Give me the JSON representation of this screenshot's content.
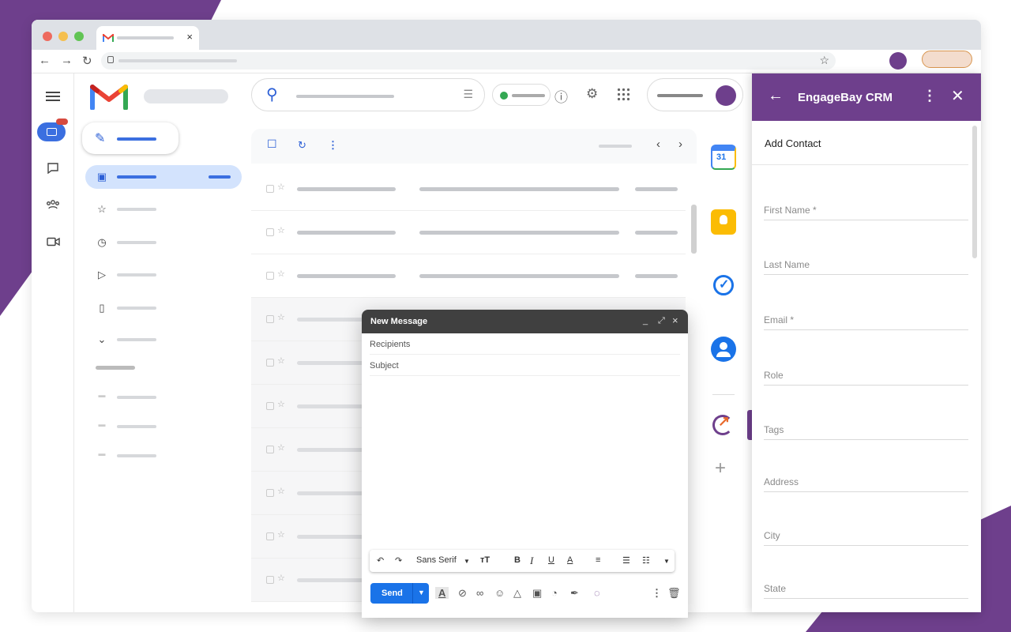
{
  "browser": {
    "dot_colors": [
      "#ee6a5e",
      "#f5bf4f",
      "#61c454"
    ],
    "tab_close": "×",
    "nav": {
      "back": "←",
      "forward": "→",
      "reload": "↻",
      "bookmark": "☆"
    }
  },
  "gmail": {
    "brand_colors": {
      "blue": "#4285f4",
      "red": "#ea4335",
      "yellow": "#fbbc04",
      "green": "#34a853"
    },
    "rail_icons": [
      "menu-icon",
      "mail-icon",
      "chat-icon",
      "spaces-icon",
      "meet-icon"
    ],
    "nav_icons": [
      "inbox-icon",
      "star-icon",
      "clock-icon",
      "send-icon",
      "draft-icon",
      "chevron-down-icon"
    ],
    "toolbar": {
      "prev": "‹",
      "next": "›"
    }
  },
  "compose": {
    "title": "New Message",
    "controls": {
      "minimize": "_",
      "expand": "⤢",
      "close": "×"
    },
    "recipients_placeholder": "Recipients",
    "subject_placeholder": "Subject",
    "font": "Sans Serif",
    "send_label": "Send"
  },
  "crm": {
    "title": "EngageBay CRM",
    "subtitle": "Add Contact",
    "accent": "#6e3f8c",
    "fields": [
      "First Name *",
      "Last Name",
      "Email *",
      "Role",
      "Tags",
      "Address",
      "City",
      "State"
    ]
  }
}
